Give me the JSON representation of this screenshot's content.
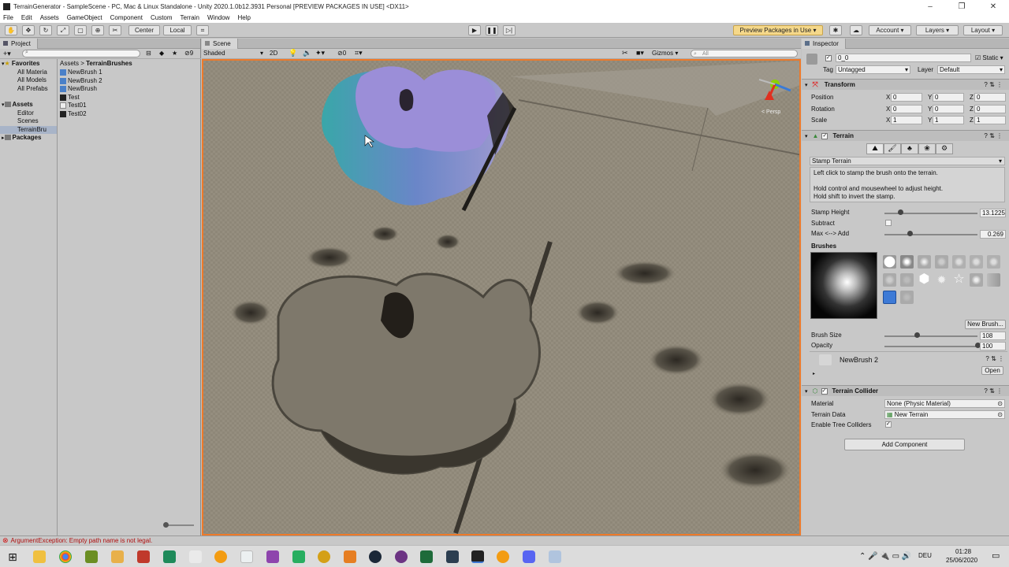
{
  "window": {
    "title": "TerrainGenerator - SampleScene - PC, Mac & Linux Standalone - Unity 2020.1.0b12.3931 Personal [PREVIEW PACKAGES IN USE] <DX11>"
  },
  "menu": [
    "File",
    "Edit",
    "Assets",
    "GameObject",
    "Component",
    "Custom",
    "Terrain",
    "Window",
    "Help"
  ],
  "toolbar": {
    "center": "Center",
    "local": "Local",
    "preview": "Preview Packages in Use",
    "account": "Account",
    "layers": "Layers",
    "layout": "Layout"
  },
  "project": {
    "tab": "Project",
    "hidden_count": "9",
    "tree": [
      {
        "label": "Favorites",
        "bold": true,
        "indent": 0
      },
      {
        "label": "All Materia",
        "bold": false,
        "indent": 1
      },
      {
        "label": "All Models",
        "bold": false,
        "indent": 1
      },
      {
        "label": "All Prefabs",
        "bold": false,
        "indent": 1
      },
      {
        "label": "Assets",
        "bold": true,
        "indent": 0
      },
      {
        "label": "Editor",
        "bold": false,
        "indent": 1
      },
      {
        "label": "Scenes",
        "bold": false,
        "indent": 1
      },
      {
        "label": "TerrainBru",
        "bold": false,
        "indent": 1
      },
      {
        "label": "Packages",
        "bold": true,
        "indent": 0
      }
    ],
    "breadcrumb": [
      "Assets",
      "TerrainBrushes"
    ],
    "files": [
      {
        "label": "NewBrush 1",
        "kind": "brush"
      },
      {
        "label": "NewBrush 2",
        "kind": "brush"
      },
      {
        "label": "NewBrush",
        "kind": "brush"
      },
      {
        "label": "Test",
        "kind": "texture"
      },
      {
        "label": "Test01",
        "kind": "texture2"
      },
      {
        "label": "Test02",
        "kind": "texture"
      }
    ]
  },
  "scene": {
    "tab": "Scene",
    "shading": "Shaded",
    "mode2d": "2D",
    "fx_count": "0",
    "gizmos": "Gizmos",
    "search_placeholder": "All",
    "persp": "< Persp"
  },
  "inspector": {
    "tab": "Inspector",
    "object_name": "0_0",
    "static_label": "Static",
    "tag_label": "Tag",
    "tag_value": "Untagged",
    "layer_label": "Layer",
    "layer_value": "Default",
    "transform": {
      "title": "Transform",
      "rows": [
        {
          "label": "Position",
          "x": "0",
          "y": "0",
          "z": "0"
        },
        {
          "label": "Rotation",
          "x": "0",
          "y": "0",
          "z": "0"
        },
        {
          "label": "Scale",
          "x": "1",
          "y": "1",
          "z": "1"
        }
      ]
    },
    "terrain": {
      "title": "Terrain",
      "tool": "Stamp Terrain",
      "help1": "Left click to stamp the brush onto the terrain.",
      "help2": "Hold control and mousewheel to adjust height.",
      "help3": "Hold shift to invert the stamp.",
      "stamp_height_label": "Stamp Height",
      "stamp_height_value": "13.1225",
      "stamp_height_fraction": 0.17,
      "subtract_label": "Subtract",
      "maxadd_label": "Max <--> Add",
      "maxadd_value": "0.269",
      "maxadd_fraction": 0.27,
      "brushes_label": "Brushes",
      "new_brush": "New Brush...",
      "brush_size_label": "Brush Size",
      "brush_size_value": "108",
      "brush_size_fraction": 0.35,
      "opacity_label": "Opacity",
      "opacity_value": "100",
      "opacity_fraction": 1.0,
      "brush_name": "NewBrush 2",
      "open": "Open"
    },
    "collider": {
      "title": "Terrain Collider",
      "material_label": "Material",
      "material_value": "None (Physic Material)",
      "data_label": "Terrain Data",
      "data_value": "New Terrain",
      "trees_label": "Enable Tree Colliders"
    },
    "add_component": "Add Component"
  },
  "status": {
    "message": "ArgumentException: Empty path name is not legal."
  },
  "taskbar": {
    "time": "01:28",
    "date": "25/06/2020",
    "lang": "DEU"
  },
  "colors": {
    "accent": "#ee7a2a",
    "error": "#d01010",
    "selection": "#3d7ad6"
  }
}
